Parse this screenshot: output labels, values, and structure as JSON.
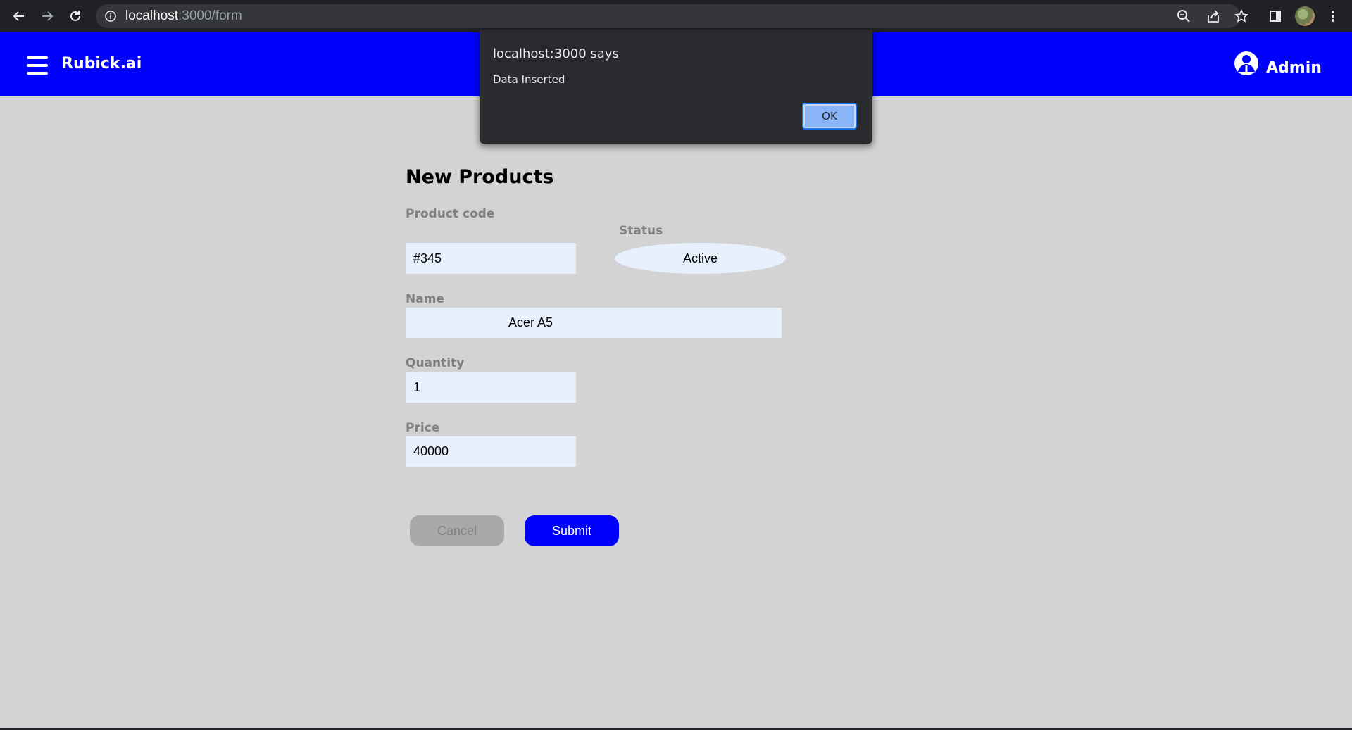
{
  "browser": {
    "url_host": "localhost",
    "url_path": ":3000/form"
  },
  "header": {
    "brand": "Rubick.ai",
    "user_label": "Admin"
  },
  "form": {
    "title": "New Products",
    "product_code_label": "Product code",
    "product_code_value": "#345",
    "status_label": "Status",
    "status_value": "Active",
    "name_label": "Name",
    "name_value": "Acer A5",
    "quantity_label": "Quantity",
    "quantity_value": "1",
    "price_label": "Price",
    "price_value": "40000",
    "cancel_label": "Cancel",
    "submit_label": "Submit"
  },
  "dialog": {
    "title": "localhost:3000 says",
    "message": "Data Inserted",
    "ok_label": "OK"
  }
}
